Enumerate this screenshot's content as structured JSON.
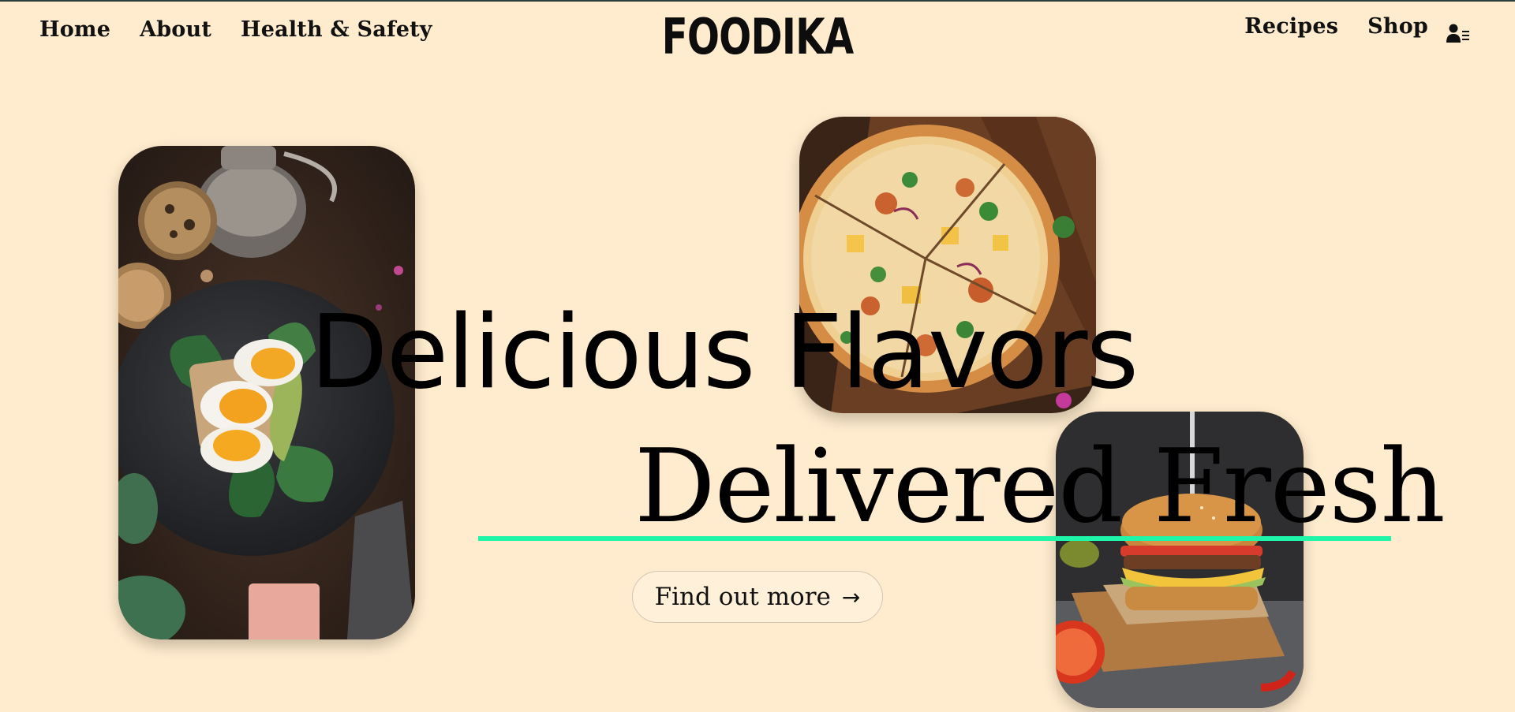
{
  "brand": {
    "logo": "FOODIKA"
  },
  "nav": {
    "left": [
      {
        "label": "Home"
      },
      {
        "label": "About"
      },
      {
        "label": "Health & Safety"
      }
    ],
    "right": [
      {
        "label": "Recipes"
      },
      {
        "label": "Shop"
      }
    ],
    "account_icon": "user-list-icon"
  },
  "hero": {
    "line1": "Delicious Flavors",
    "line2": "Delivered Fresh",
    "accent_color": "#1ff5a8",
    "cta": {
      "label": "Find out more",
      "icon": "arrow-right-icon",
      "arrow": "→"
    }
  },
  "images": [
    {
      "name": "egg-avocado-toast-photo"
    },
    {
      "name": "pizza-photo"
    },
    {
      "name": "burger-photo"
    }
  ],
  "colors": {
    "background": "#ffebcd",
    "text": "#111111"
  }
}
